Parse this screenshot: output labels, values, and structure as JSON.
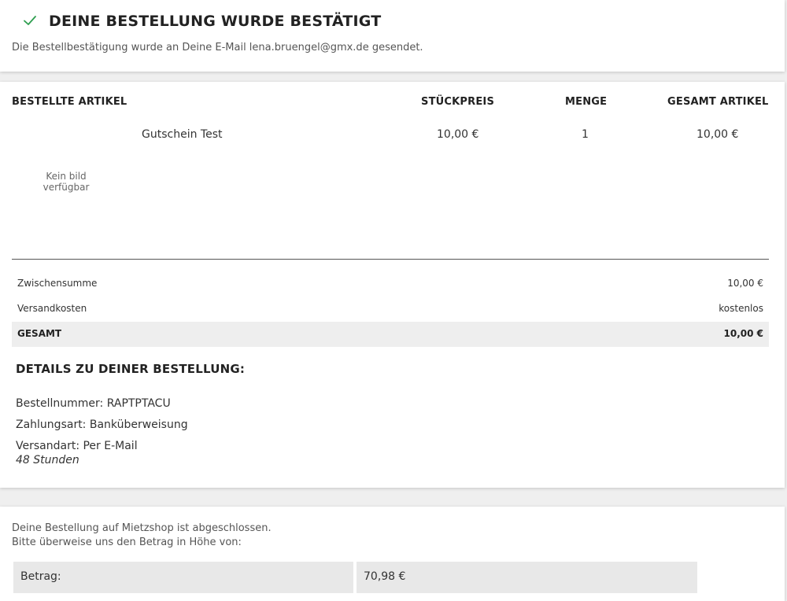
{
  "confirmation": {
    "icon": "checkmark-icon",
    "title": "DEINE BESTELLUNG WURDE BESTÄTIGT",
    "subtitle": "Die Bestellbestätigung wurde an Deine E-Mail lena.bruengel@gmx.de gesendet."
  },
  "order_table": {
    "headers": [
      "BESTELLTE ARTIKEL",
      "STÜCKPREIS",
      "MENGE",
      "GESAMT ARTIKEL"
    ],
    "rows": [
      {
        "name": "Gutschein Test",
        "image_placeholder": "Kein bild verfügbar",
        "unit_price": "10,00 €",
        "quantity": "1",
        "total": "10,00 €"
      }
    ]
  },
  "summary": {
    "subtotal_label": "Zwischensumme",
    "subtotal_value": "10,00 €",
    "shipping_label": "Versandkosten",
    "shipping_value": "kostenlos",
    "total_label": "GESAMT",
    "total_value": "10,00 €"
  },
  "details": {
    "heading": "DETAILS ZU DEINER BESTELLUNG:",
    "order_number": "Bestellnummer: RAPTPTACU",
    "payment_method": "Zahlungsart: Banküberweisung",
    "shipping_method": "Versandart: Per E-Mail",
    "shipping_note": "48 Stunden"
  },
  "payment_info": {
    "line1": "Deine Bestellung auf Mietzshop ist abgeschlossen.",
    "line2": "Bitte überweise uns den Betrag in Höhe von:",
    "amount_label": "Betrag:",
    "amount_value": "70,98 €"
  },
  "colors": {
    "accent_check": "#2e9e4f",
    "background": "#efefef",
    "card": "#ffffff",
    "total_row": "#eeeeee"
  }
}
